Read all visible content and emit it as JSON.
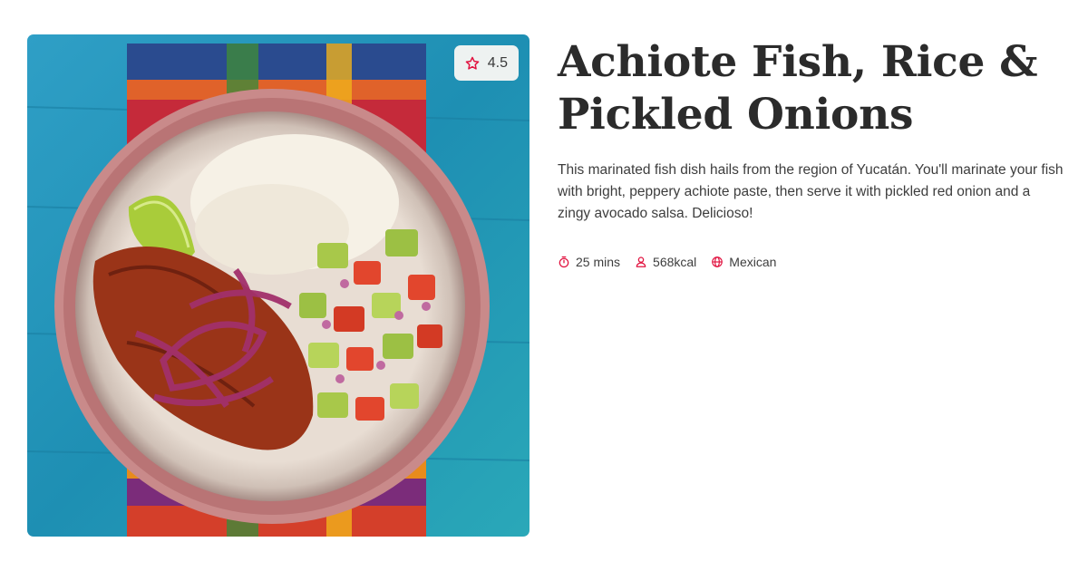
{
  "recipe": {
    "title_line1": "Achiote Fish, Rice &",
    "title_line2": "Pickled Onions",
    "description": "This marinated fish dish hails from the region of Yucatán. You'll marinate your fish with bright, peppery achiote paste, then serve it with pickled red onion and a zingy avocado salsa. Delicioso!",
    "rating": "4.5",
    "meta": {
      "time": "25 mins",
      "energy": "568kcal",
      "cuisine": "Mexican"
    }
  },
  "icons": {
    "rating": "star-icon",
    "time": "stopwatch-icon",
    "energy": "person-icon",
    "cuisine": "globe-icon"
  },
  "colors": {
    "accent": "#e1123f",
    "title": "#2b2b2b",
    "text": "#3d3d3d",
    "rating_bg": "#eef2f1"
  }
}
